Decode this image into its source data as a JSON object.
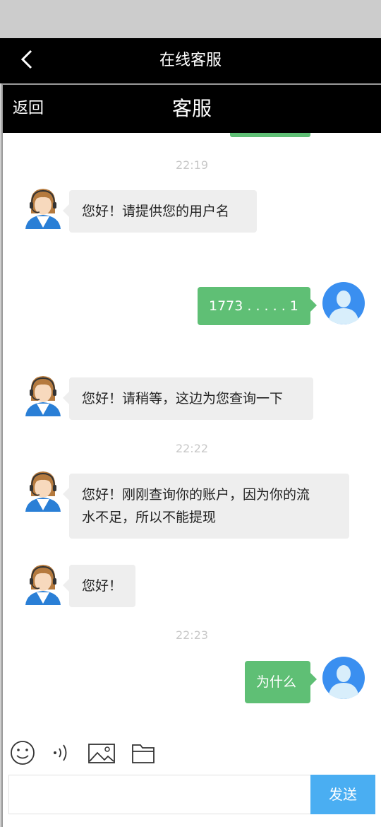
{
  "app_header": {
    "title": "在线客服",
    "back_icon": "chevron-left-icon"
  },
  "inner_header": {
    "back_label": "返回",
    "title": "客服"
  },
  "chat": {
    "timestamps": [
      "22:19",
      "22:22",
      "22:23"
    ],
    "messages": [
      {
        "sender": "agent",
        "text": "您好！请提供您的用户名"
      },
      {
        "sender": "user",
        "text": "1773 . . . . . 1"
      },
      {
        "sender": "agent",
        "text": "您好！请稍等，这边为您查询一下"
      },
      {
        "sender": "agent",
        "line1": "您好！刚刚查询你的账户，因为你的流",
        "line2": "水不足，所以不能提现"
      },
      {
        "sender": "agent",
        "text": "您好！"
      },
      {
        "sender": "user",
        "text": "为什么"
      }
    ]
  },
  "toolbar": {
    "icons": [
      "emoji-icon",
      "voice-icon",
      "image-icon",
      "folder-icon"
    ]
  },
  "composer": {
    "placeholder": "",
    "send_label": "发送"
  },
  "colors": {
    "user_bubble": "#5fbf75",
    "agent_bubble": "#eeeeee",
    "send_button": "#4aaef2",
    "header": "#000000"
  }
}
